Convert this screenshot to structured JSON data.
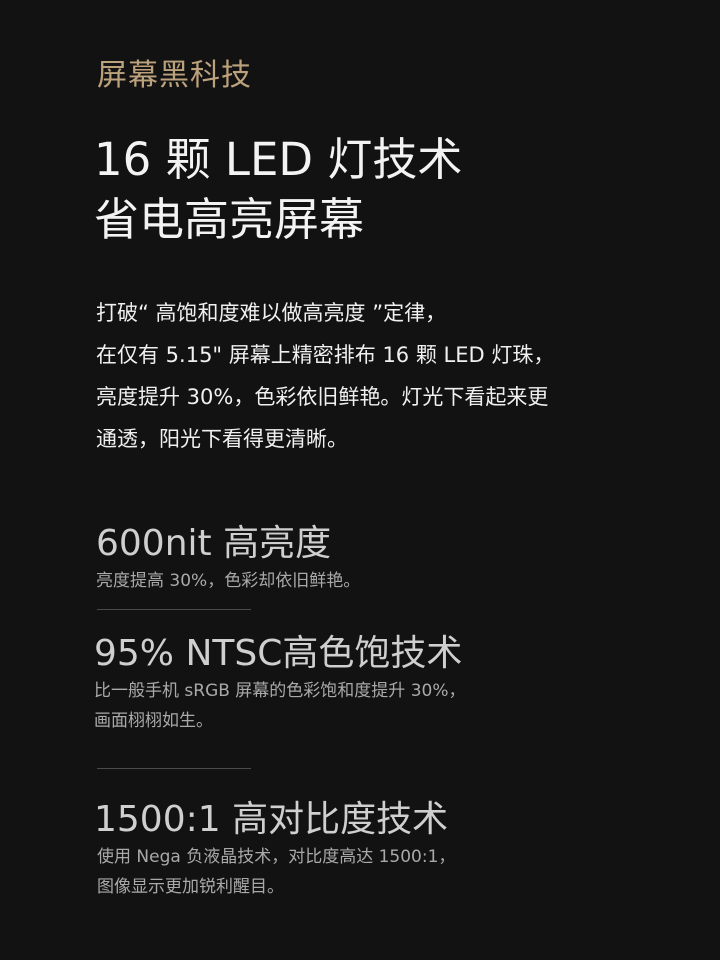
{
  "eyebrow": "屏幕黑科技",
  "headline": {
    "line1": "16 颗 LED 灯技术",
    "line2": "省电高亮屏幕"
  },
  "body": {
    "line1": "打破“ 高饱和度难以做高亮度 ”定律，",
    "line2": "在仅有 5.15\" 屏幕上精密排布 16 颗 LED 灯珠，",
    "line3": "亮度提升 30%，色彩依旧鲜艳。灯光下看起来更",
    "line4": "通透，阳光下看得更清晰。"
  },
  "features": [
    {
      "title": "600nit 高亮度",
      "desc1": "亮度提高 30%，色彩却依旧鲜艳。",
      "desc2": ""
    },
    {
      "title": "95% NTSC高色饱技术",
      "desc1": "比一般手机 sRGB 屏幕的色彩饱和度提升 30%，",
      "desc2": "画面栩栩如生。"
    },
    {
      "title": "1500:1 高对比度技术",
      "desc1": "使用 Nega 负液晶技术，对比度高达 1500:1，",
      "desc2": "图像显示更加锐利醒目。"
    }
  ],
  "colors": {
    "background": "#121212",
    "accent": "#bca27c",
    "headline": "#f3f3f3",
    "feature_title": "#cfcfcf",
    "feature_desc": "#a9a9a9"
  }
}
